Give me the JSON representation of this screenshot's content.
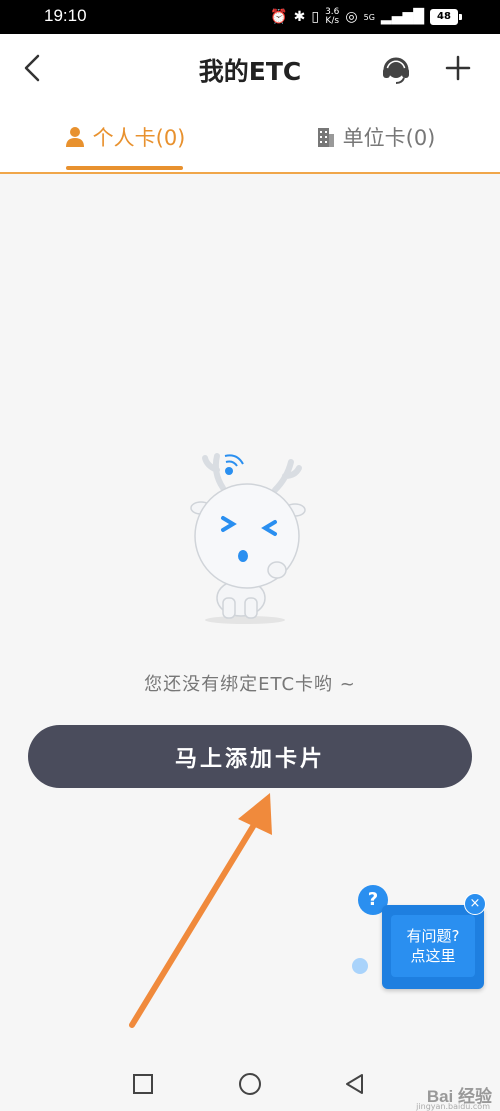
{
  "status_bar": {
    "time": "19:10",
    "net_speed_value": "3.6",
    "net_speed_unit": "K/s",
    "signal_label": "5G",
    "battery": "48"
  },
  "header": {
    "title": "我的ETC",
    "back_icon": "chevron-left-icon",
    "support_icon": "headset-icon",
    "add_icon": "plus-icon"
  },
  "tabs": [
    {
      "label": "个人卡(0)",
      "icon": "person-icon",
      "active": true
    },
    {
      "label": "单位卡(0)",
      "icon": "building-icon",
      "active": false
    }
  ],
  "empty_state": {
    "message": "您还没有绑定ETC卡哟 ~",
    "button_label": "马上添加卡片"
  },
  "help_widget": {
    "line1": "有问题?",
    "line2": "点这里",
    "question_mark": "?",
    "close": "×"
  },
  "watermark": {
    "text": "Bai 经验",
    "sub": "jingyan.baidu.com"
  },
  "colors": {
    "accent": "#e8912e",
    "button_bg": "#4a4c5c",
    "help_blue": "#1e7fe0",
    "annotation_arrow": "#f08a3c"
  }
}
